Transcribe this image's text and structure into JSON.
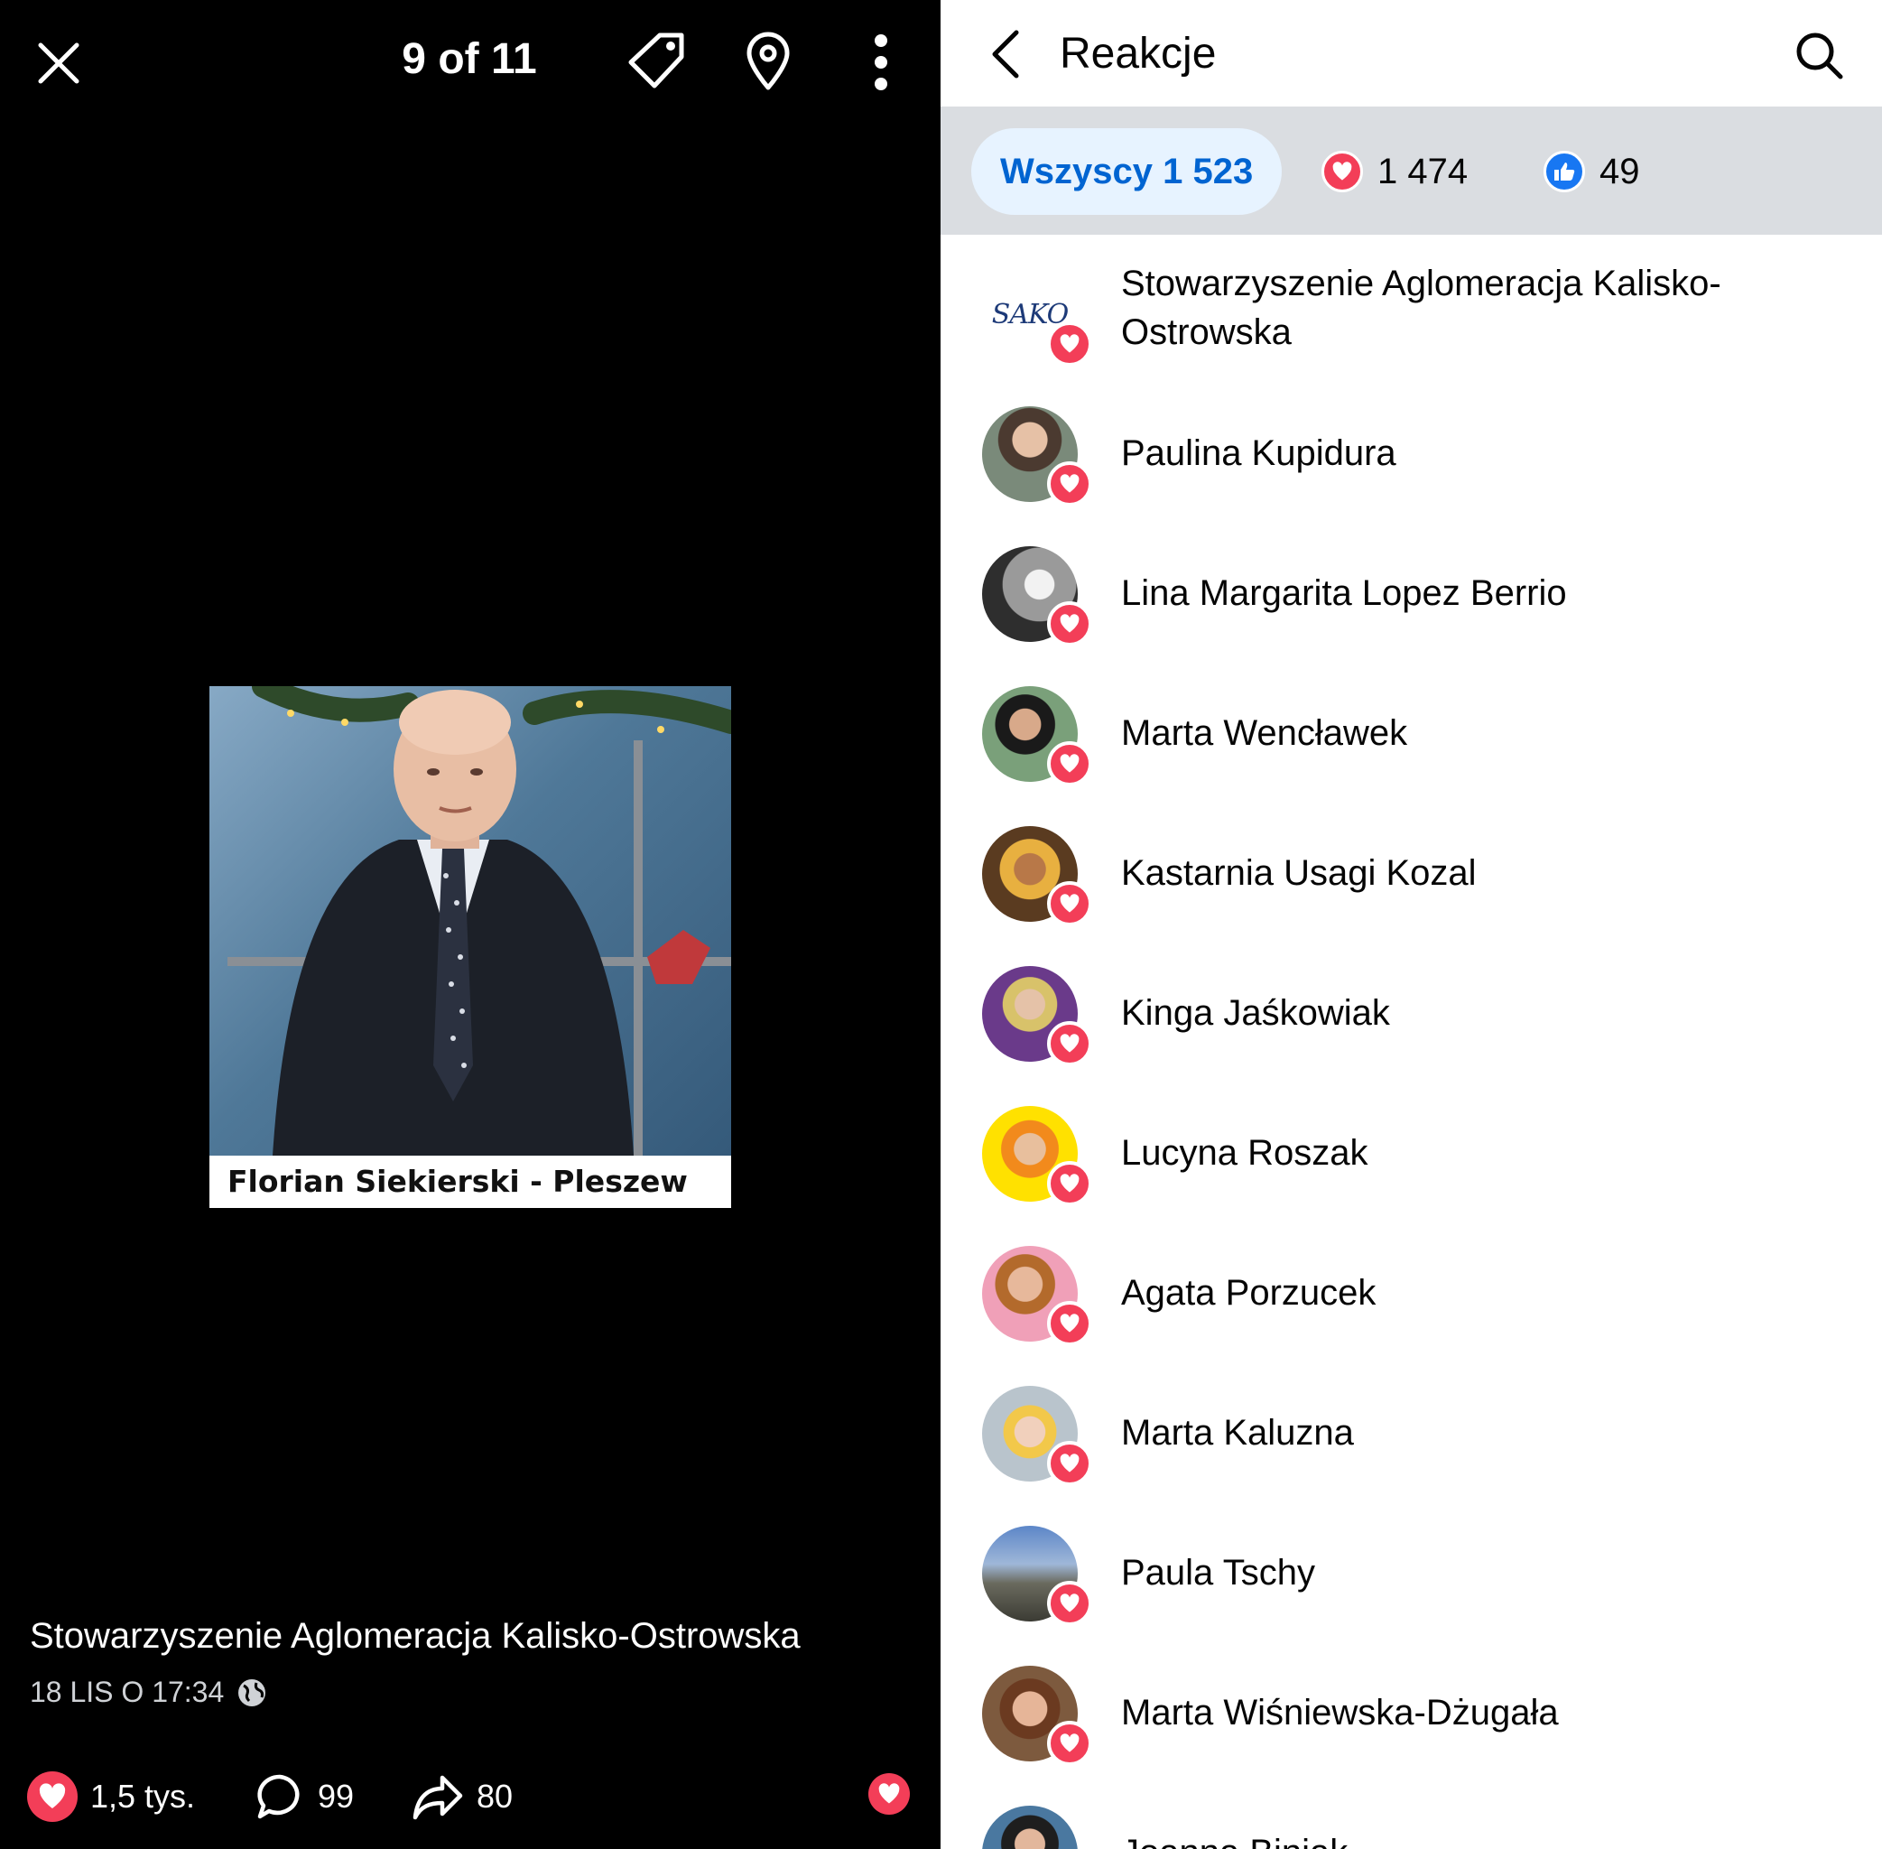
{
  "viewer": {
    "counter": "9 of 11",
    "photo_caption": "Florian Siekierski - Pleszew",
    "post_author": "Stowarzyszenie Aglomeracja Kalisko-Ostrowska",
    "post_time": "18 LIS O 17:34",
    "reactions_count": "1,5 tys.",
    "comments_count": "99",
    "shares_count": "80",
    "icons": [
      "close-icon",
      "tag-icon",
      "location-pin-icon",
      "more-vertical-icon",
      "globe-icon",
      "heart-reaction-icon",
      "comment-icon",
      "share-icon"
    ]
  },
  "panel": {
    "title": "Reakcje",
    "filters": {
      "all_label": "Wszyscy 1 523",
      "love_count": "1 474",
      "like_count": "49"
    },
    "reactions": [
      {
        "name": "Stowarzyszenie Aglomeracja Kalisko-Ostrowska",
        "reaction": "love",
        "avatar_logo": "SAKO"
      },
      {
        "name": "Paulina Kupidura",
        "reaction": "love"
      },
      {
        "name": "Lina Margarita Lopez Berrio",
        "reaction": "love"
      },
      {
        "name": "Marta Wencławek",
        "reaction": "love"
      },
      {
        "name": "Kastarnia Usagi Kozal",
        "reaction": "love"
      },
      {
        "name": "Kinga Jaśkowiak",
        "reaction": "love"
      },
      {
        "name": "Lucyna Roszak",
        "reaction": "love"
      },
      {
        "name": "Agata Porzucek",
        "reaction": "love"
      },
      {
        "name": "Marta Kaluzna",
        "reaction": "love"
      },
      {
        "name": "Paula Tschy",
        "reaction": "love"
      },
      {
        "name": "Marta Wiśniewska-Dżugała",
        "reaction": "love"
      },
      {
        "name": "Joanna Biniak",
        "reaction": "love"
      }
    ]
  },
  "colors": {
    "love": "#f33e58",
    "like": "#1877f2",
    "tab_active_bg": "#e7f3ff",
    "tab_active_text": "#0064d1",
    "filter_bar_bg": "#dadde1"
  }
}
